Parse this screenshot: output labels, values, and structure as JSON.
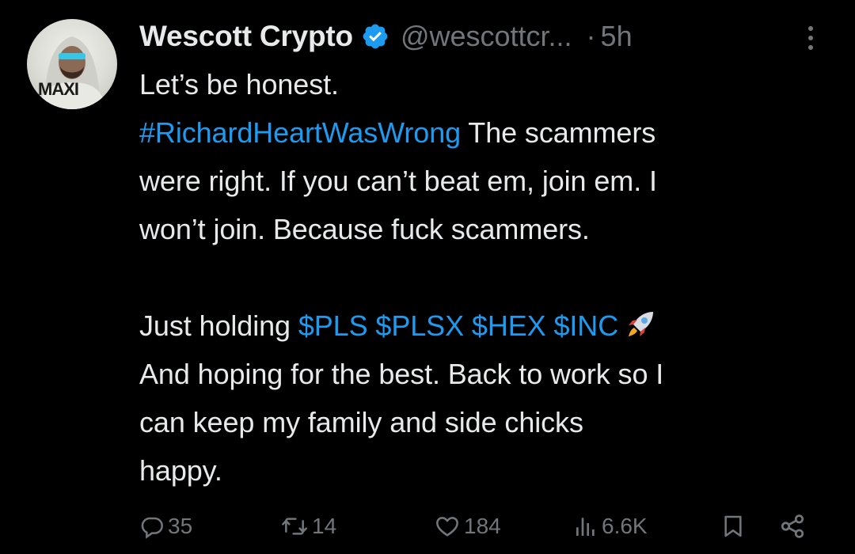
{
  "author": {
    "display_name": "Wescott Crypto",
    "handle": "@wescottcr...",
    "verified": true,
    "avatar_text": "MAXI"
  },
  "timestamp": {
    "separator": "·",
    "value": "5h"
  },
  "tweet": {
    "line1": "Let’s be honest.",
    "line2_hashtag": "#RichardHeartWasWrong",
    "line2_rest": " The scammers",
    "line3": "were right. If you can’t beat em, join em. I",
    "line4": "won’t join. Because fuck scammers.",
    "line5_prefix": "Just holding ",
    "cashtags": [
      "$PLS",
      "$PLSX",
      "$HEX",
      "$INC"
    ],
    "line6": "And hoping for the best. Back to work so I",
    "line7": "can keep my family and side chicks",
    "line8": "happy."
  },
  "actions": {
    "replies": "35",
    "reposts": "14",
    "likes": "184",
    "views": "6.6K"
  },
  "icons": {
    "verified": "verified-badge-icon",
    "more": "more-options-icon",
    "reply": "reply-icon",
    "repost": "repost-icon",
    "like": "heart-icon",
    "views": "views-chart-icon",
    "bookmark": "bookmark-icon",
    "share": "share-icon",
    "emoji": "rocket-emoji"
  },
  "colors": {
    "background": "#000000",
    "text": "#e7e9ea",
    "muted": "#71767b",
    "link": "#1d9bf0"
  }
}
